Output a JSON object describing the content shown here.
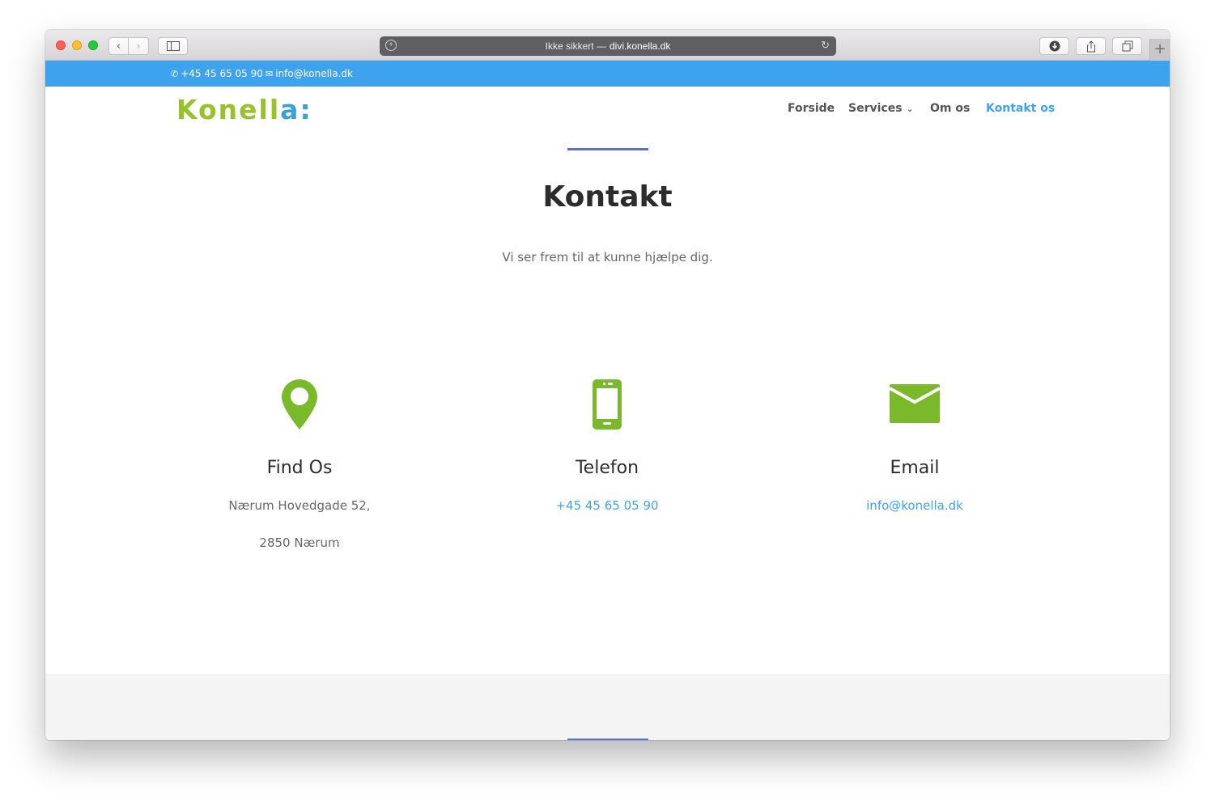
{
  "browser": {
    "url_prefix": "Ikke sikkert —",
    "url_domain": "divi.konella.dk"
  },
  "topbar": {
    "phone": "+45 45 65 05 90",
    "email": "info@konella.dk"
  },
  "header": {
    "logo_main": "Konell",
    "logo_accent": "a",
    "logo_suffix": ":",
    "menu": {
      "forside": "Forside",
      "services": "Services",
      "om_os": "Om os",
      "kontakt_os": "Kontakt os"
    }
  },
  "main": {
    "title": "Kontakt",
    "subtitle": "Vi ser frem til at kunne hjælpe dig.",
    "columns": {
      "find": {
        "title": "Find Os",
        "line1": "Nærum Hovedgade 52,",
        "line2": "2850 Nærum"
      },
      "phone": {
        "title": "Telefon",
        "value": "+45 45 65 05 90"
      },
      "email": {
        "title": "Email",
        "value": "info@konella.dk"
      }
    }
  },
  "colors": {
    "topbar": "#3ea3ef",
    "accent_link": "#3ea3ef",
    "icon_green": "#7ab929",
    "divider": "#5a6fd6",
    "logo_green": "#98c12e"
  },
  "icons": [
    "location-pin-icon",
    "mobile-phone-icon",
    "envelope-icon"
  ]
}
